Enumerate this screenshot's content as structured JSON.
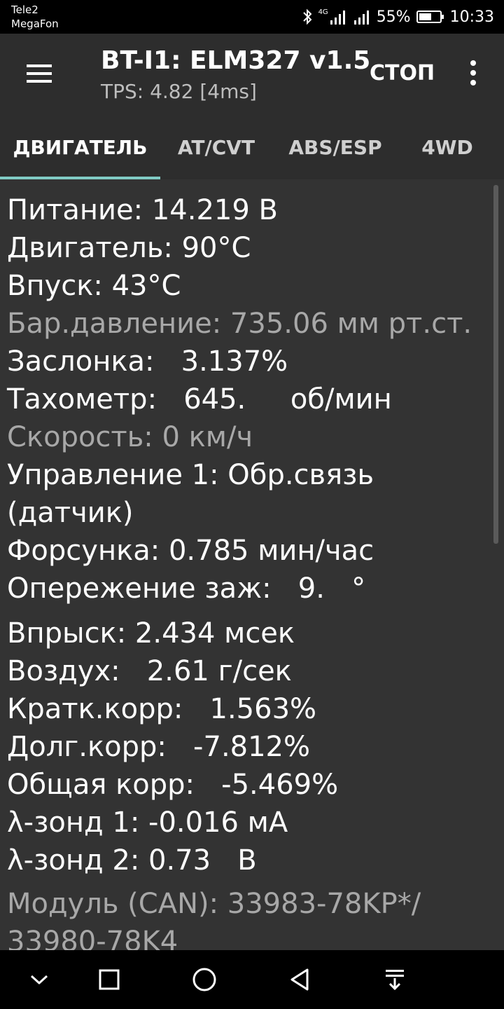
{
  "status_bar": {
    "carrier_1": "Tele2",
    "carrier_2": "MegaFon",
    "network_type": "4G",
    "battery": "55%",
    "time": "10:33"
  },
  "app_bar": {
    "title": "BT-I1: ELM327 v1.5",
    "subtitle": "TPS: 4.82 [4ms]",
    "stop_label": "СТОП"
  },
  "tabs": [
    {
      "label": "ДВИГАТЕЛЬ",
      "active": true
    },
    {
      "label": "AT/CVT",
      "active": false
    },
    {
      "label": "ABS/ESP",
      "active": false
    },
    {
      "label": "4WD",
      "active": false
    }
  ],
  "readings": [
    "Питание: 14.219 В",
    "Двигатель: 90°C",
    "Впуск: 43°C",
    "Бар.давление: 735.06 мм рт.ст.",
    "Заслонка:   3.137%",
    "Тахометр:   645.     об/мин",
    "Скорость: 0 км/ч",
    "Управление 1: Обр.связь",
    "(датчик)",
    "Форсунка: 0.785 мин/час",
    "Опережение заж:   9.   °",
    "Впрыск: 2.434 мсек",
    "Воздух:   2.61 г/сек",
    "Кратк.корр:   1.563%",
    "Долг.корр:   -7.812%",
    "Общая корр:   -5.469%",
    "λ-зонд 1: -0.016 мА",
    "λ-зонд 2: 0.73   В",
    "Модуль (CAN): 33983-78KP*/",
    "33980-78K4"
  ],
  "colors": {
    "tab_indicator": "#80cbc4",
    "background": "#333333",
    "dim_text": "#a8a8a8"
  },
  "nav_icons": [
    "chevron-down-icon",
    "square-icon",
    "circle-icon",
    "back-triangle-icon",
    "notification-pull-icon"
  ]
}
